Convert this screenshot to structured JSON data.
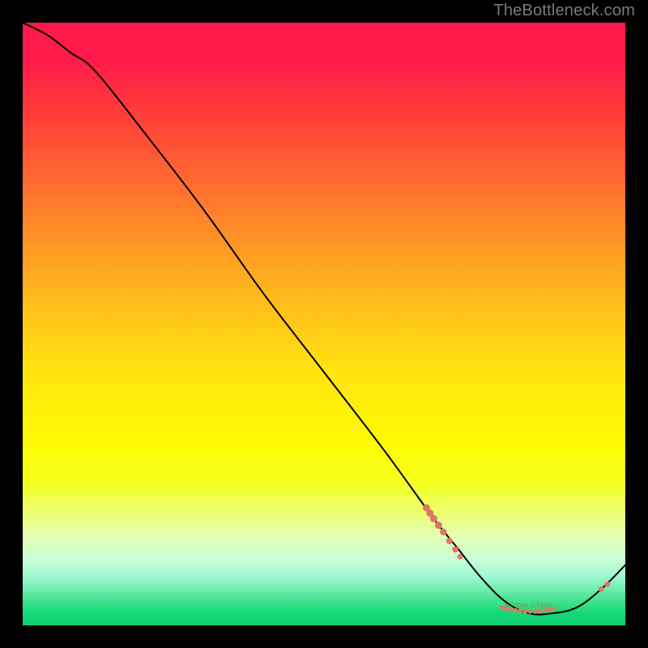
{
  "watermark": {
    "text": "TheBottleneck.com"
  },
  "plot": {
    "tiny_label": "NVIDIA GT640"
  },
  "chart_data": {
    "type": "line",
    "title": "",
    "xlabel": "",
    "ylabel": "",
    "xlim": [
      0,
      100
    ],
    "ylim": [
      0,
      100
    ],
    "grid": false,
    "legend": null,
    "series": [
      {
        "name": "curve",
        "x": [
          0,
          4,
          8,
          12,
          20,
          30,
          40,
          50,
          60,
          68,
          72,
          76,
          80,
          84,
          88,
          92,
          96,
          100
        ],
        "y": [
          100,
          98,
          95,
          92,
          82,
          69,
          55,
          42,
          29,
          18,
          13,
          8,
          4,
          2,
          2,
          3,
          6,
          10
        ]
      }
    ],
    "markers": [
      {
        "name": "left-cluster",
        "points": [
          {
            "x": 67.0,
            "y": 19.5,
            "r": 4.5
          },
          {
            "x": 67.6,
            "y": 18.6,
            "r": 4.5
          },
          {
            "x": 68.2,
            "y": 17.7,
            "r": 4.5
          },
          {
            "x": 69.0,
            "y": 16.6,
            "r": 4.5
          },
          {
            "x": 69.8,
            "y": 15.5,
            "r": 4.2
          },
          {
            "x": 70.8,
            "y": 14.0,
            "r": 4.0
          },
          {
            "x": 71.8,
            "y": 12.6,
            "r": 3.8
          },
          {
            "x": 72.6,
            "y": 11.4,
            "r": 3.5
          }
        ]
      },
      {
        "name": "trough-cluster",
        "points": [
          {
            "x": 79.5,
            "y": 3.0,
            "r": 2.8
          },
          {
            "x": 80.2,
            "y": 2.8,
            "r": 2.8
          },
          {
            "x": 81.0,
            "y": 2.6,
            "r": 2.8
          },
          {
            "x": 81.8,
            "y": 2.5,
            "r": 2.8
          },
          {
            "x": 82.6,
            "y": 2.4,
            "r": 2.8
          },
          {
            "x": 83.4,
            "y": 2.3,
            "r": 2.8
          },
          {
            "x": 84.2,
            "y": 2.3,
            "r": 2.8
          },
          {
            "x": 85.0,
            "y": 2.3,
            "r": 2.8
          },
          {
            "x": 85.8,
            "y": 2.4,
            "r": 2.8
          },
          {
            "x": 86.6,
            "y": 2.5,
            "r": 2.8
          },
          {
            "x": 87.4,
            "y": 2.6,
            "r": 2.8
          },
          {
            "x": 88.2,
            "y": 2.8,
            "r": 2.8
          }
        ]
      },
      {
        "name": "right-pair",
        "points": [
          {
            "x": 96.0,
            "y": 6.0,
            "r": 3.5
          },
          {
            "x": 97.0,
            "y": 6.8,
            "r": 3.5
          }
        ]
      }
    ],
    "colors": {
      "curve": "#000000",
      "markers": "#e07764",
      "gradient_top": "#ff1a49",
      "gradient_mid": "#ffe40f",
      "gradient_bottom": "#0fce6f"
    }
  }
}
